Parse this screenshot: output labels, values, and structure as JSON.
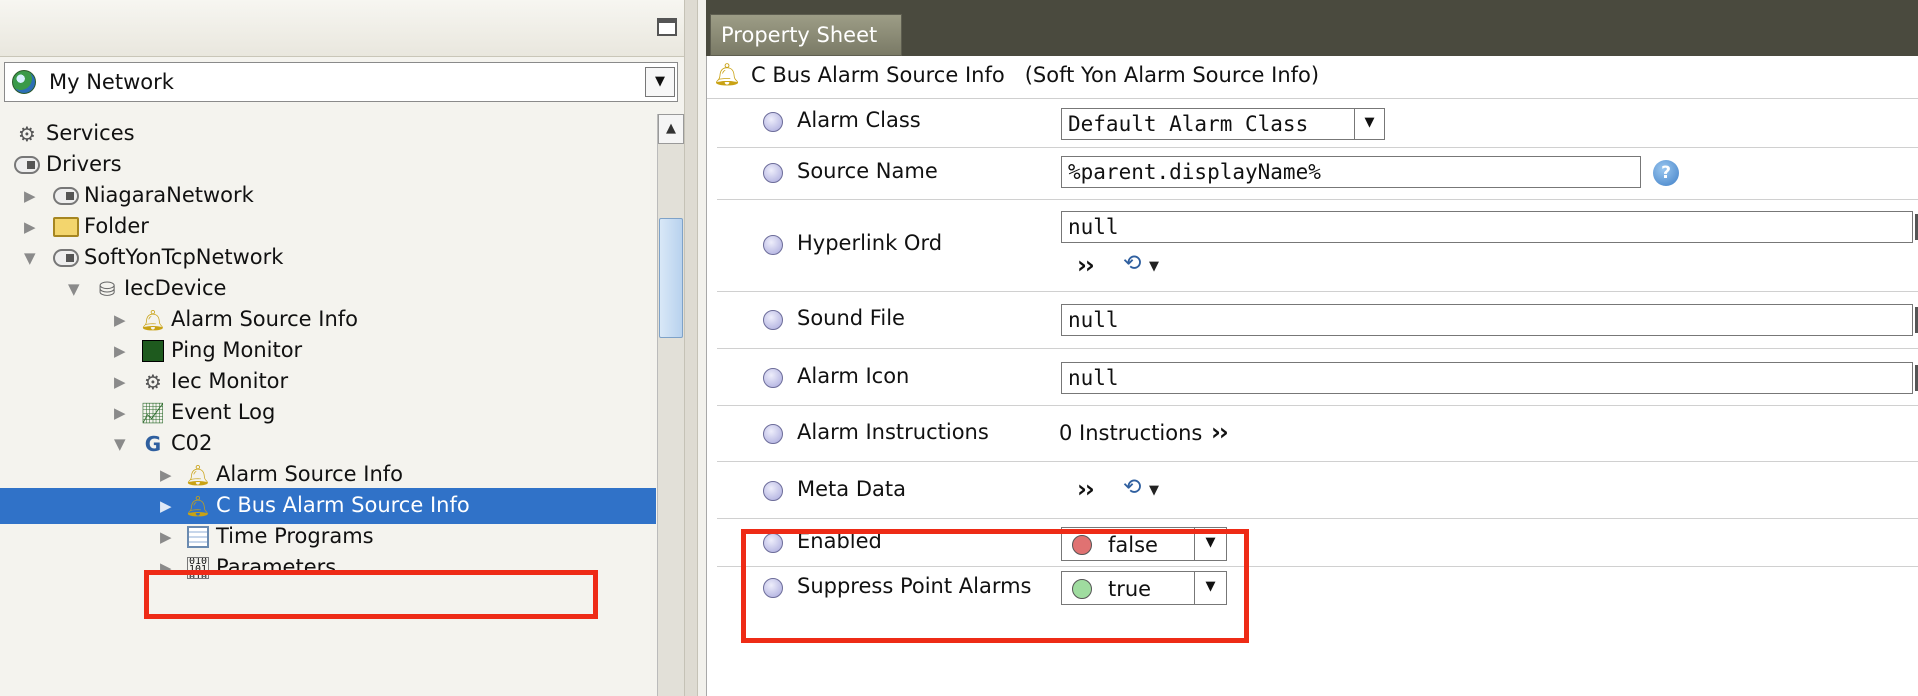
{
  "nav": {
    "network_select": {
      "value": "My Network"
    },
    "tree": [
      {
        "label": "Services",
        "icon": "gear-icon",
        "indent": 0,
        "expander": "none"
      },
      {
        "label": "Drivers",
        "icon": "network-cloud-icon",
        "indent": 0,
        "expander": "none"
      },
      {
        "label": "NiagaraNetwork",
        "icon": "network-cloud-icon",
        "indent": 1,
        "expander": "collapsed"
      },
      {
        "label": "Folder",
        "icon": "folder-icon",
        "indent": 1,
        "expander": "collapsed"
      },
      {
        "label": "SoftYonTcpNetwork",
        "icon": "network-cloud-icon",
        "indent": 1,
        "expander": "expanded"
      },
      {
        "label": "IecDevice",
        "icon": "device-icon",
        "indent": 2,
        "expander": "expanded"
      },
      {
        "label": "Alarm Source Info",
        "icon": "bell-icon",
        "indent": 3,
        "expander": "collapsed"
      },
      {
        "label": "Ping Monitor",
        "icon": "monitor-grid-icon",
        "indent": 3,
        "expander": "collapsed"
      },
      {
        "label": "Iec Monitor",
        "icon": "gear-icon",
        "indent": 3,
        "expander": "collapsed"
      },
      {
        "label": "Event Log",
        "icon": "event-log-icon",
        "indent": 3,
        "expander": "collapsed"
      },
      {
        "label": "C02",
        "icon": "bus-device-icon",
        "indent": 3,
        "expander": "expanded"
      },
      {
        "label": "Alarm Source Info",
        "icon": "bell-icon",
        "indent": 4,
        "expander": "collapsed"
      },
      {
        "label": "C Bus Alarm Source Info",
        "icon": "bell-icon",
        "indent": 4,
        "expander": "collapsed",
        "selected": true
      },
      {
        "label": "Time Programs",
        "icon": "calendar-icon",
        "indent": 4,
        "expander": "collapsed"
      },
      {
        "label": "Parameters",
        "icon": "binary-icon",
        "indent": 4,
        "expander": "collapsed"
      }
    ]
  },
  "tab": {
    "label": "Property Sheet"
  },
  "component": {
    "label": "C Bus Alarm Source Info   (Soft Yon Alarm Source Info)"
  },
  "properties": {
    "alarm_class": {
      "name": "Alarm Class",
      "value": "Default Alarm Class"
    },
    "source_name": {
      "name": "Source Name",
      "value": "%parent.displayName%"
    },
    "hyperlink_ord": {
      "name": "Hyperlink Ord",
      "value": "null"
    },
    "sound_file": {
      "name": "Sound File",
      "value": "null"
    },
    "alarm_icon": {
      "name": "Alarm Icon",
      "value": "null"
    },
    "alarm_instructions": {
      "name": "Alarm Instructions",
      "value": "0 Instructions"
    },
    "meta_data": {
      "name": "Meta Data"
    },
    "enabled": {
      "name": "Enabled",
      "value": "false",
      "led_color": "#e07272"
    },
    "suppress_point_alarms": {
      "name": "Suppress Point Alarms",
      "value": "true",
      "led_color": "#9fdc9f"
    }
  },
  "colors": {
    "selection": "#3072c8",
    "highlight": "#ee2b16",
    "tab_strip": "#4a4a3e"
  }
}
